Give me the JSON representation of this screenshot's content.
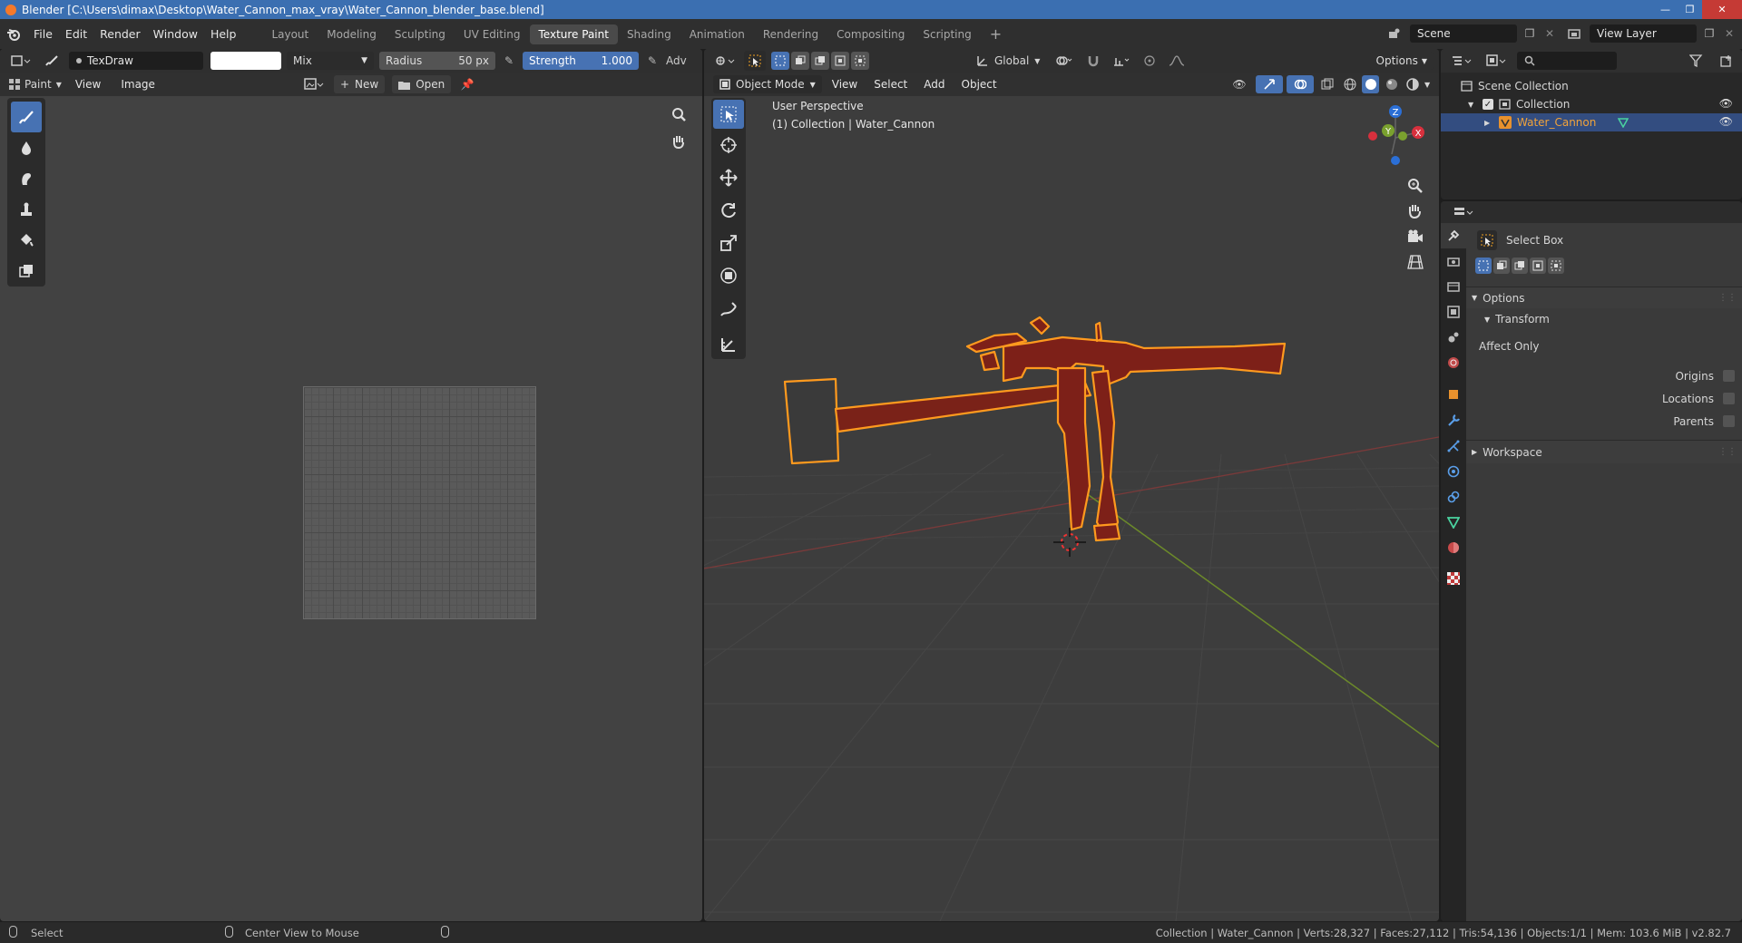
{
  "window": {
    "title": "Blender [C:\\Users\\dimax\\Desktop\\Water_Cannon_max_vray\\Water_Cannon_blender_base.blend]"
  },
  "menus": [
    "File",
    "Edit",
    "Render",
    "Window",
    "Help"
  ],
  "workspace_tabs": [
    "Layout",
    "Modeling",
    "Sculpting",
    "UV Editing",
    "Texture Paint",
    "Shading",
    "Animation",
    "Rendering",
    "Compositing",
    "Scripting"
  ],
  "active_workspace": "Texture Paint",
  "scene": {
    "name": "Scene",
    "view_layer": "View Layer"
  },
  "image_editor": {
    "brush_name": "TexDraw",
    "blend_mode": "Mix",
    "radius_label": "Radius",
    "radius_value": "50 px",
    "strength_label": "Strength",
    "strength_value": "1.000",
    "adv_label": "Adv",
    "mode_label": "Paint",
    "menu_view": "View",
    "menu_image": "Image",
    "new_label": "New",
    "open_label": "Open"
  },
  "viewport": {
    "mode": "Object Mode",
    "menus": [
      "View",
      "Select",
      "Add",
      "Object"
    ],
    "orientation": "Global",
    "options_label": "Options",
    "overlay_line1": "User Perspective",
    "overlay_line2": "(1) Collection | Water_Cannon",
    "gizmo_axes": [
      "Z",
      "Y",
      "X"
    ]
  },
  "outliner": {
    "root": "Scene Collection",
    "collection": "Collection",
    "object": "Water_Cannon"
  },
  "properties": {
    "tool_name": "Select Box",
    "section_options": "Options",
    "subsection_transform": "Transform",
    "affect_only": "Affect Only",
    "checks": [
      "Origins",
      "Locations",
      "Parents"
    ],
    "section_workspace": "Workspace"
  },
  "status": {
    "left_hint": "Select",
    "mid_hint": "Center View to Mouse",
    "stats": "Collection | Water_Cannon | Verts:28,327 | Faces:27,112 | Tris:54,136 | Objects:1/1 | Mem: 103.6 MiB | v2.82.7"
  },
  "colors": {
    "accent": "#4772b3",
    "selection": "#f0a020",
    "title_bar": "#3b6fb1"
  }
}
